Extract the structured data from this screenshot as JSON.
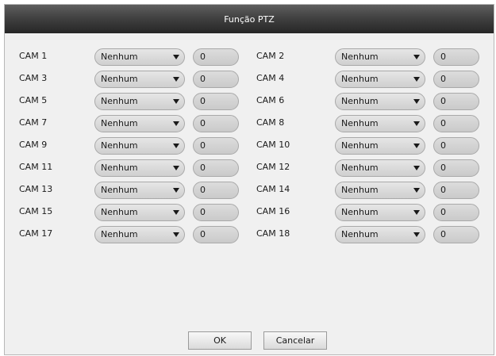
{
  "dialog": {
    "title": "Função PTZ",
    "ok_label": "OK",
    "cancel_label": "Cancelar"
  },
  "cameras": [
    {
      "label": "CAM 1",
      "protocol": "Nenhum",
      "address": "0"
    },
    {
      "label": "CAM 2",
      "protocol": "Nenhum",
      "address": "0"
    },
    {
      "label": "CAM 3",
      "protocol": "Nenhum",
      "address": "0"
    },
    {
      "label": "CAM 4",
      "protocol": "Nenhum",
      "address": "0"
    },
    {
      "label": "CAM 5",
      "protocol": "Nenhum",
      "address": "0"
    },
    {
      "label": "CAM 6",
      "protocol": "Nenhum",
      "address": "0"
    },
    {
      "label": "CAM 7",
      "protocol": "Nenhum",
      "address": "0"
    },
    {
      "label": "CAM 8",
      "protocol": "Nenhum",
      "address": "0"
    },
    {
      "label": "CAM 9",
      "protocol": "Nenhum",
      "address": "0"
    },
    {
      "label": "CAM 10",
      "protocol": "Nenhum",
      "address": "0"
    },
    {
      "label": "CAM 11",
      "protocol": "Nenhum",
      "address": "0"
    },
    {
      "label": "CAM 12",
      "protocol": "Nenhum",
      "address": "0"
    },
    {
      "label": "CAM 13",
      "protocol": "Nenhum",
      "address": "0"
    },
    {
      "label": "CAM 14",
      "protocol": "Nenhum",
      "address": "0"
    },
    {
      "label": "CAM 15",
      "protocol": "Nenhum",
      "address": "0"
    },
    {
      "label": "CAM 16",
      "protocol": "Nenhum",
      "address": "0"
    },
    {
      "label": "CAM 17",
      "protocol": "Nenhum",
      "address": "0"
    },
    {
      "label": "CAM 18",
      "protocol": "Nenhum",
      "address": "0"
    }
  ],
  "icons": {
    "dropdown": "chevron-down-icon"
  }
}
